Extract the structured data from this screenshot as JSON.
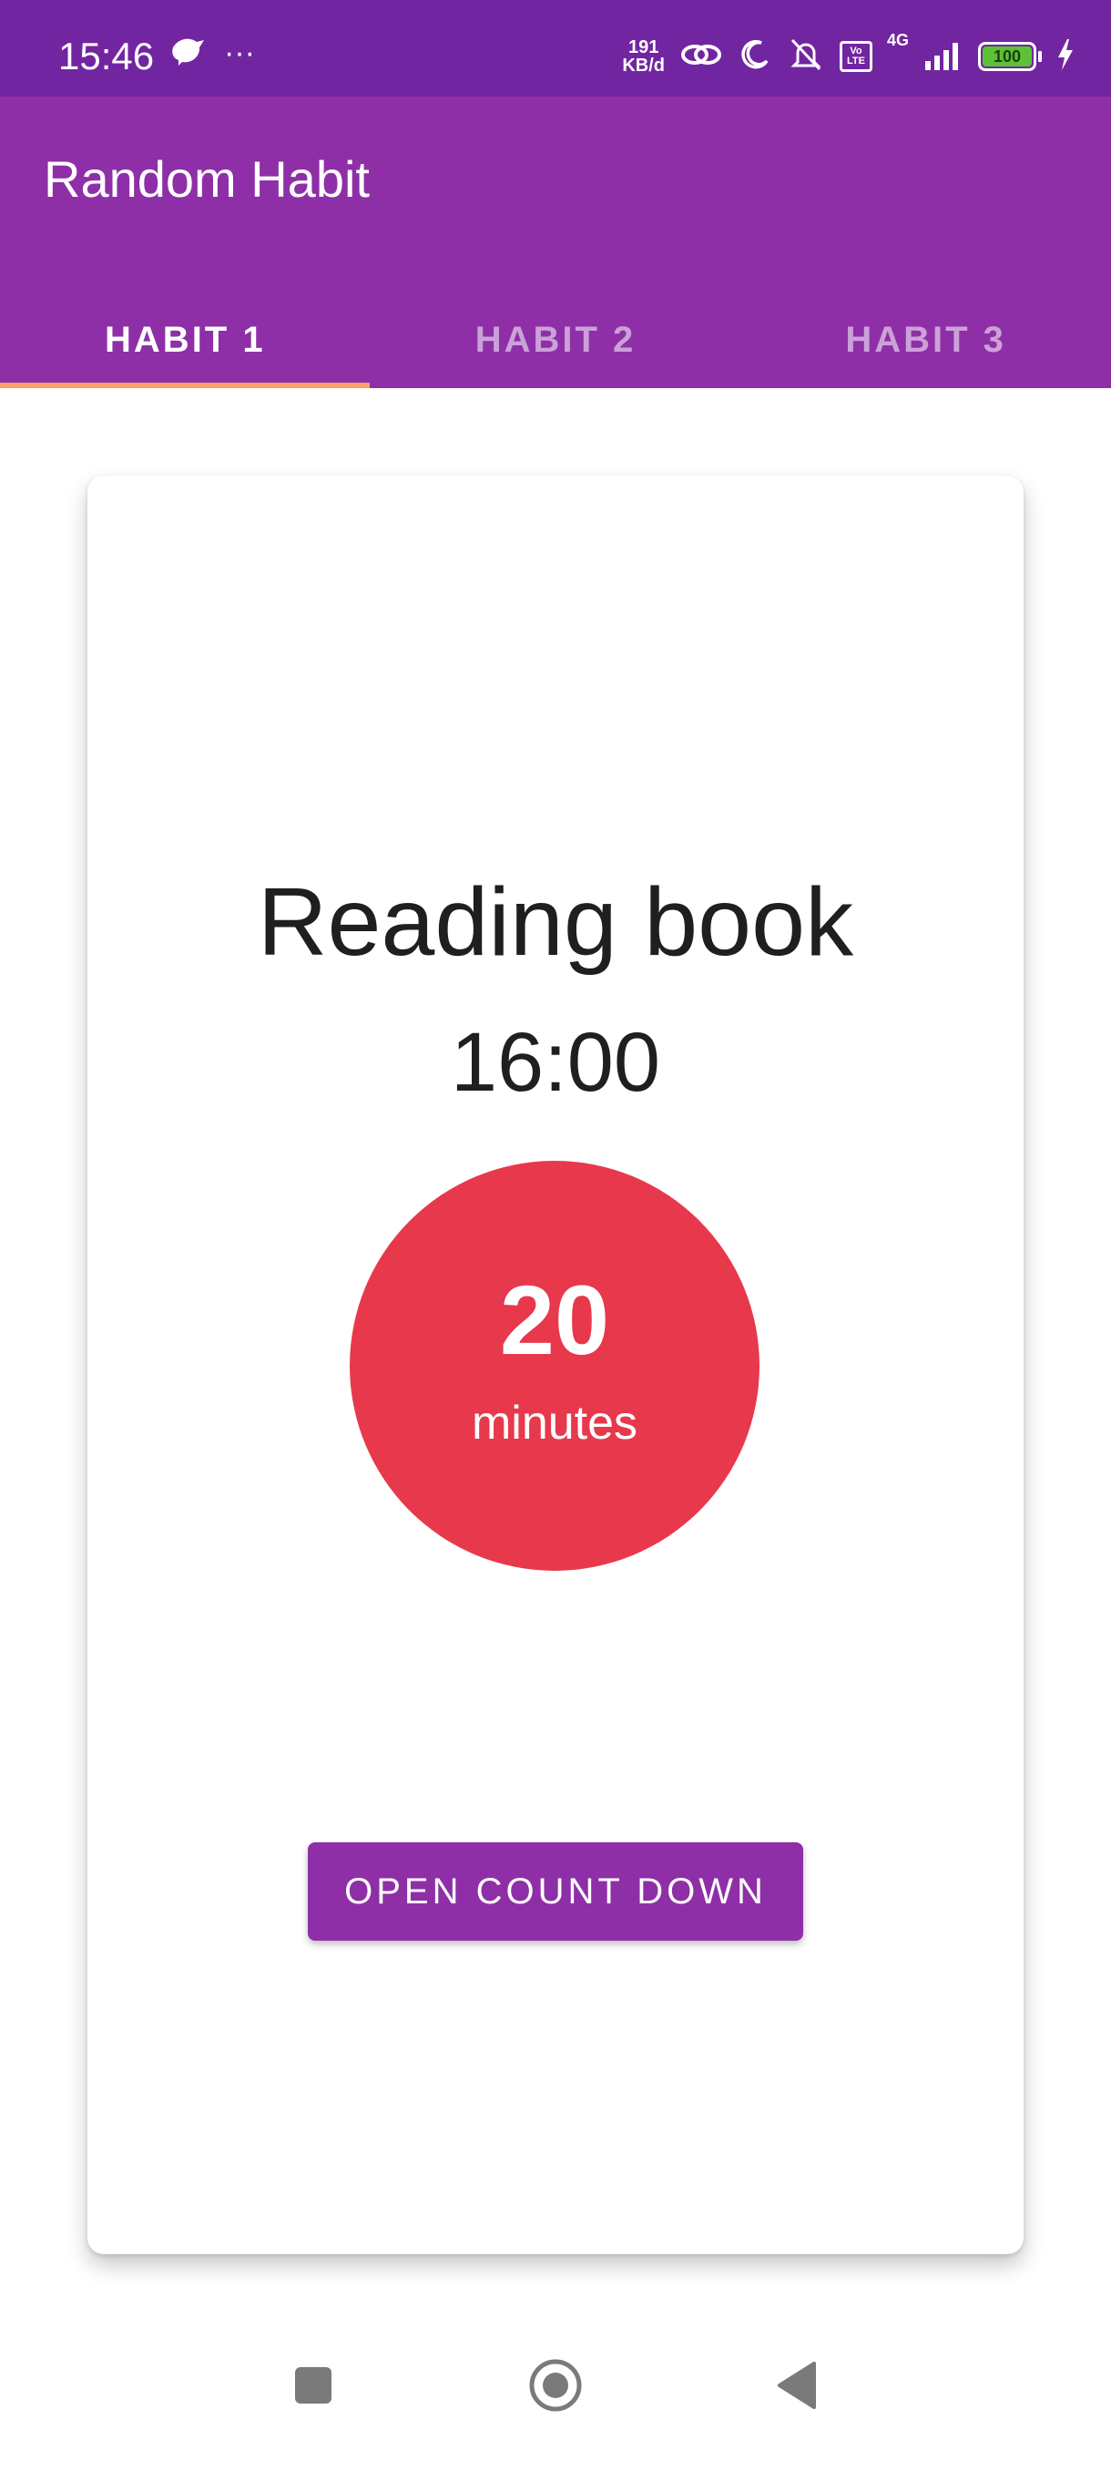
{
  "status_bar": {
    "time": "15:46",
    "more": "···",
    "net_speed_value": "191",
    "net_speed_unit": "KB/d",
    "network_type": "4G",
    "volte": "Vo LTE",
    "battery": "100"
  },
  "app_bar": {
    "title": "Random Habit"
  },
  "tabs": [
    {
      "label": "HABIT 1",
      "selected": true
    },
    {
      "label": "HABIT 2",
      "selected": false
    },
    {
      "label": "HABIT 3",
      "selected": false
    }
  ],
  "habit": {
    "name": "Reading book",
    "time": "16:00",
    "duration_value": "20",
    "duration_unit": "minutes"
  },
  "actions": {
    "countdown_label": "OPEN COUNT DOWN"
  },
  "colors": {
    "status_bar": "#7125A1",
    "app_bar": "#8E2FA8",
    "tab_indicator": "#FF9E6B",
    "duration_circle": "#E8384C",
    "button": "#8E2FA8"
  },
  "icons": {
    "status_left": [
      "bird-icon"
    ],
    "status_right": [
      "link-icon",
      "moon-icon",
      "bell-muted-icon",
      "volte-icon",
      "signal-icon",
      "battery-icon",
      "charging-icon"
    ],
    "nav": [
      "recents-icon",
      "home-icon",
      "back-icon"
    ]
  }
}
